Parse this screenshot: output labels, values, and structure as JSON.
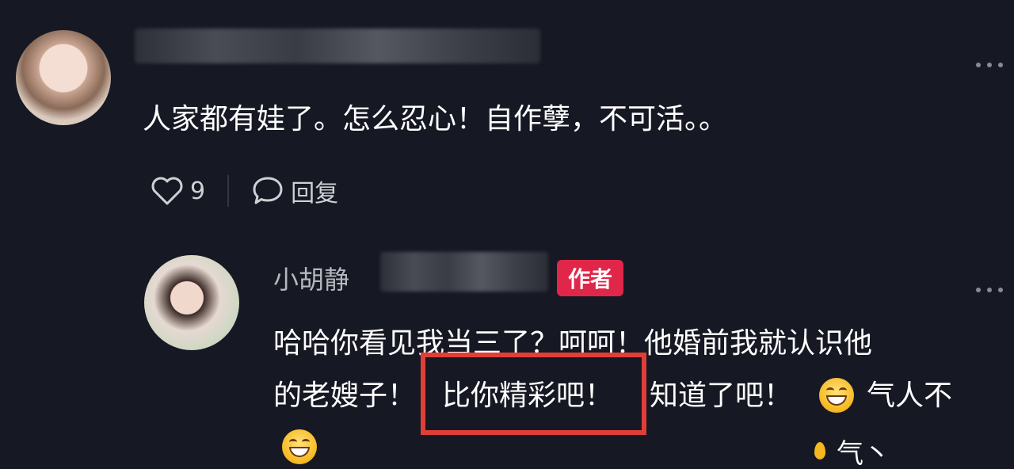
{
  "comment": {
    "text": "人家都有娃了。怎么忍心！自作孽，不可活。。",
    "likes": "9",
    "reply_label": "回复"
  },
  "reply": {
    "username": "小胡静",
    "badge": "作者",
    "line1": "哈哈你看见我当三了？呵呵！他婚前我就认识他",
    "line2_a": "的老嫂子！",
    "line2_highlight": "比你精彩吧！",
    "line2_b": "知道了吧！",
    "line2_c": "气人不",
    "line3_tail": "气丶"
  },
  "icons": {
    "like": "heart-icon",
    "reply": "chat-bubble-icon",
    "more": "more-dots-icon",
    "emoji": "grinning-face-emoji"
  },
  "colors": {
    "background": "#161823",
    "badge": "#e0274a",
    "highlight_border": "#e03f39"
  }
}
